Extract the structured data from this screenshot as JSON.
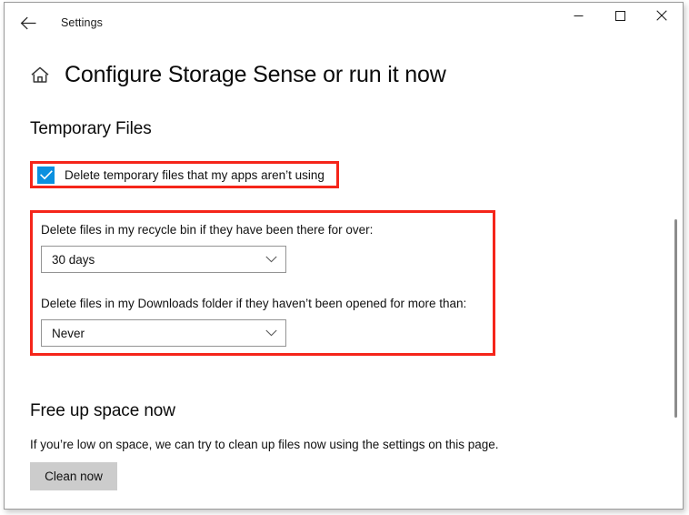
{
  "window": {
    "app_title": "Settings",
    "back_icon": "back-arrow-icon",
    "controls": {
      "minimize": "—",
      "maximize": "□",
      "close": "✕"
    }
  },
  "page": {
    "home_icon": "home-icon",
    "title": "Configure Storage Sense or run it now"
  },
  "temporary_files": {
    "heading": "Temporary Files",
    "checkbox": {
      "label": "Delete temporary files that my apps aren’t using",
      "checked": true
    },
    "recycle_bin": {
      "label": "Delete files in my recycle bin if they have been there for over:",
      "value": "30 days"
    },
    "downloads": {
      "label": "Delete files in my Downloads folder if they haven’t been opened for more than:",
      "value": "Never"
    }
  },
  "free_up_space": {
    "heading": "Free up space now",
    "description": "If you’re low on space, we can try to clean up files now using the settings on this page.",
    "button_label": "Clean now"
  },
  "colors": {
    "annotation_red": "#f5251a",
    "checkbox_blue": "#0b90df",
    "button_gray": "#cccccc"
  }
}
